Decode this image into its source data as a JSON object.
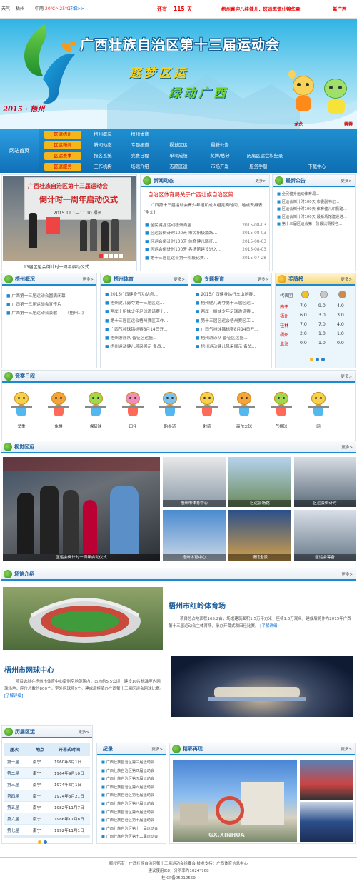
{
  "topbar": {
    "label_weather": "天气：",
    "city": "梧州",
    "date_text": "中雨",
    "temp": "20℃～25℃",
    "detail_link": "详细>>",
    "countdown_prefix": "还有",
    "countdown_days": "115",
    "countdown_suffix": "天",
    "marquee1": "梧州喜迎八桂健儿，区运再谱壮锦华章",
    "marquee2": "新广西"
  },
  "banner": {
    "title": "广西壮族自治区第十三届运动会",
    "slogan1": "逐梦区运",
    "slogan2": "绿动广西",
    "year_city": "2015 · 梧州",
    "mascot1": "龙龙",
    "mascot2": "蓉蓉"
  },
  "nav": {
    "home": "网站首页",
    "rows": [
      [
        "区运梧州",
        "梧州概况",
        "梧州体育",
        "",
        "",
        "",
        "",
        ""
      ],
      [
        "区运新闻",
        "新闻动态",
        "专题报道",
        "视觉区运",
        "最新公告",
        "",
        "",
        ""
      ],
      [
        "区运赛事",
        "报名系统",
        "竞赛日程",
        "单项成绩",
        "奖牌/总分",
        "历届区运会和纪录",
        "",
        ""
      ],
      [
        "区运服务",
        "工作机构",
        "场馆介绍",
        "志愿区运",
        "市场开发",
        "服务手册",
        "下载中心",
        ""
      ]
    ]
  },
  "slideshow": {
    "board_title": "广西壮族自治区第十三届运动会",
    "board_sub": "倒计时一周年启动仪式",
    "board_date": "2015.11.1—11.10 梧州",
    "caption": "13届区运会倒计时一周年启动仪式"
  },
  "news": {
    "title": "新闻动态",
    "more": "更多>",
    "headline": "自治区体育局关于广西壮族自治区第...",
    "summary": "广西第十三届运动会青少年组和成人组竞赛时间、地点安排表[全文]",
    "items": [
      {
        "text": "全民健身活动梧州首届...",
        "date": "2015-08-03"
      },
      {
        "text": "区运会倒计时100天 市民积极踊跃...",
        "date": "2015-08-03"
      },
      {
        "text": "区运会倒计时100天 体育健儿踏征...",
        "date": "2015-08-03"
      },
      {
        "text": "区运会倒计时100天 各场馆建设进入...",
        "date": "2015-08-03"
      },
      {
        "text": "第十三届区运会第一阶段比赛...",
        "date": "2015-07-28"
      }
    ]
  },
  "notice": {
    "title": "最新公告",
    "more": "更多>",
    "items": [
      "全民健身运动体育局...",
      "区运会倒计时100天 市委副书记...",
      "区运会倒计时100天 体育健儿积极踏...",
      "区运会倒计时100天 最新场馆建设进...",
      "第十三届区运会第一阶段比赛报名..."
    ]
  },
  "overview": {
    "title": "梧州概况",
    "more": "更多>",
    "items": [
      "广西第十三届运动会圆满闭幕",
      "广西第十三届运动会宣传片",
      "广西第十三届运动会会歌——《梧州...》"
    ]
  },
  "sports": {
    "title": "梧州体育",
    "more": "更多>",
    "items": [
      "2015广西健身气功站点...",
      "梧州健儿勇夺第十三届区运...",
      "两岸十姐妹少年足球邀请赛十...",
      "第十三届区运会梧州赛区工作...",
      "广西气排球锦标赛8月14日开...",
      "梧州游泳队 备征区运盛...",
      "梧州运动健儿风采展示 备战..."
    ]
  },
  "special": {
    "title": "专题报道",
    "more": "更多>",
    "items": [
      "2015广西健身站行车山地赛...",
      "梧州健儿勇夺第十三届区运...",
      "两岸十姐妹少年足球邀请赛...",
      "第十三届区运会梧州赛区工...",
      "广西气排球锦标赛8月14日开...",
      "梧州游泳队 备征区运盛...",
      "梧州运动健儿风采展示 备战..."
    ]
  },
  "medals": {
    "title": "奖牌榜",
    "more": "更多>",
    "header": [
      "代表团",
      "",
      "",
      ""
    ],
    "rows": [
      [
        "南宁",
        "7.0",
        "9.0",
        "4.0"
      ],
      [
        "梧州",
        "6.0",
        "3.0",
        "3.0"
      ],
      [
        "桂林",
        "7.0",
        "7.0",
        "4.0"
      ],
      [
        "梧州",
        "2.0",
        "1.0",
        "1.0"
      ],
      [
        "北海",
        "0.0",
        "1.0",
        "0.0"
      ]
    ]
  },
  "schedule": {
    "title": "竞赛日程",
    "more": "更多>",
    "sports": [
      "举重",
      "象棋",
      "保龄球",
      "田径",
      "跆拳道",
      "射箭",
      "高尔夫球",
      "气排球",
      "网"
    ]
  },
  "visual": {
    "title": "视觉区运",
    "more": "更多>",
    "main_caption": "区运会倒计时一周年启动仪式",
    "thumbs": [
      "梧州市体育中心",
      "区运会场馆",
      "区运会倒计时",
      "梧州体育中心",
      "场馆全景",
      "区运会筹备",
      "梧州体育场",
      "区运会开幕式彩排",
      "广西体育"
    ]
  },
  "venues": {
    "title": "场馆介绍",
    "more": "更多>",
    "v1_name": "梧州市红岭体育场",
    "v1_desc": "项目总占地面积165.2亩，场馆建筑面积1.5万平方米，座椅1.8万观众，建成后将作为2015年广西第十三届运动会主体育场，承办开幕式和田径比赛。",
    "v1_more": "[了解详细]",
    "v2_name": "梧州市网球中心",
    "v2_desc": "项目选址在梧州市体育中心南侧空地范围内，占地约5.5公顷，建设10片标准室内网球场地，座位总数约800个，室外网球场9个。建成后将承办广西第十三届区运会网球比赛。",
    "v2_more": "[了解详细]"
  },
  "history": {
    "title": "历届区运",
    "more": "更多>",
    "header": [
      "届次",
      "地点",
      "开幕式时间"
    ],
    "rows": [
      [
        "第一届",
        "南宁",
        "1960年6月1日"
      ],
      [
        "第二届",
        "南宁",
        "1964年9月10日"
      ],
      [
        "第三届",
        "南宁",
        "1974年5月1日"
      ],
      [
        "第四届",
        "南宁",
        "1974年3月21日"
      ],
      [
        "第五届",
        "南宁",
        "1982年11月7日"
      ],
      [
        "第六届",
        "南宁",
        "1986年11月8日"
      ],
      [
        "第七届",
        "南宁",
        "1992年11月1日"
      ]
    ]
  },
  "records": {
    "title": "纪录",
    "more": "更多>",
    "items": [
      "广西壮族自治区第三届运动会",
      "广西壮族自治区第四届运动会",
      "广西壮族自治区第五届运动会",
      "广西壮族自治区第六届运动会",
      "广西壮族自治区第七届运动会",
      "广西壮族自治区第八届运动会",
      "广西壮族自治区第九届运动会",
      "广西壮族自治区第十届运动会",
      "广西壮族自治区第十一届运动会",
      "广西壮族自治区第十二届运动会"
    ]
  },
  "wonderful": {
    "title": "精彩再现",
    "more": "更多>",
    "watermark": "GX.XINHUA"
  },
  "footer": {
    "line1": "版权所有：广西壮族自治区第十三届运动会组委会   技术支持：广西体育信息中心",
    "line2": "建议使用IE8，分辨率为1024*768",
    "line3": "桂ICP备05012559"
  },
  "colors": {
    "brand_blue": "#1b8ad0",
    "accent_orange": "#f5b61a",
    "alert_red": "#e00000"
  }
}
